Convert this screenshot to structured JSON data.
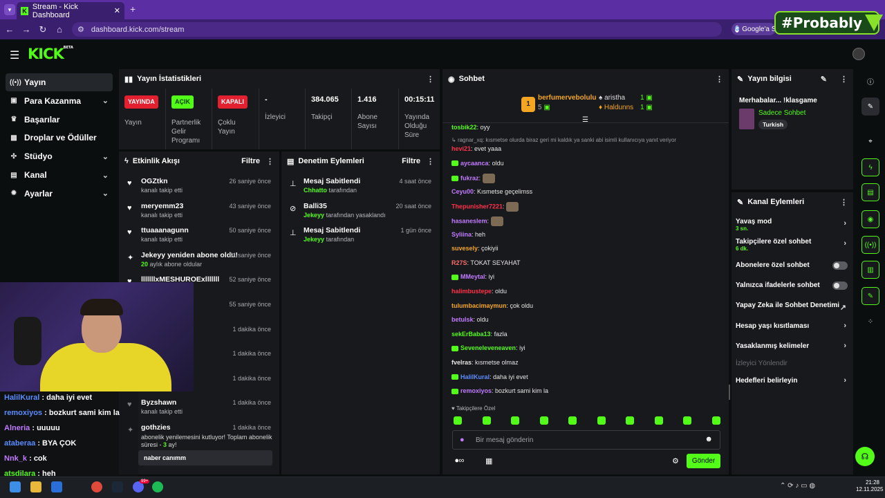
{
  "browser": {
    "tab_title": "Stream - Kick Dashboard",
    "url": "dashboard.kick.com/stream",
    "google_chip": "Google'a S",
    "watermark": "#Probably"
  },
  "header": {
    "logo": "KICK",
    "logo_sup": "BETA"
  },
  "sidebar": {
    "items": [
      {
        "label": "Yayın",
        "icon": "broadcast-icon",
        "active": true
      },
      {
        "label": "Para Kazanma",
        "icon": "money-icon",
        "chevron": true
      },
      {
        "label": "Başarılar",
        "icon": "trophy-icon"
      },
      {
        "label": "Droplar ve Ödüller",
        "icon": "gift-icon"
      },
      {
        "label": "Stüdyo",
        "icon": "studio-icon",
        "chevron": true
      },
      {
        "label": "Kanal",
        "icon": "channel-icon",
        "chevron": true
      },
      {
        "label": "Ayarlar",
        "icon": "gear-icon",
        "chevron": true
      }
    ]
  },
  "stats": {
    "title": "Yayın İstatistikleri",
    "cells": [
      {
        "badge": "YAYINDA",
        "label": "Yayın"
      },
      {
        "badge": "AÇIK",
        "label": "Partnerlik Gelir Programı"
      },
      {
        "badge": "KAPALI",
        "label": "Çoklu Yayın"
      },
      {
        "value": "-",
        "label": "İzleyici"
      },
      {
        "value": "384.065",
        "label": "Takipçi"
      },
      {
        "value": "1.416",
        "label": "Abone Sayısı"
      },
      {
        "value": "00:15:11",
        "label": "Yayında Olduğu Süre"
      }
    ]
  },
  "activity": {
    "title": "Etkinlik Akışı",
    "filter": "Filtre",
    "items": [
      {
        "name": "OGZtkn",
        "sub": "kanalı takip etti",
        "time": "26 saniye önce"
      },
      {
        "name": "meryemm23",
        "sub": "kanalı takip etti",
        "time": "43 saniye önce"
      },
      {
        "name": "ttuaaanagunn",
        "sub": "kanalı takip etti",
        "time": "50 saniye önce"
      },
      {
        "name": "Jekeyy yeniden abone oldu!",
        "sub_num": "20",
        "sub": "aylık abone oldular",
        "time": "51 saniye önce"
      },
      {
        "name": "lllllllxMESHUROExlllllll",
        "sub": "",
        "time": "52 saniye önce"
      },
      {
        "name": "",
        "sub": "",
        "time": "55 saniye önce"
      },
      {
        "name": "",
        "sub": "",
        "time": "1 dakika önce"
      },
      {
        "name": "",
        "sub": "",
        "time": "1 dakika önce"
      },
      {
        "name": "",
        "sub": "",
        "time": "1 dakika önce"
      },
      {
        "name": "Byzshawn",
        "sub": "kanalı takip etti",
        "time": "1 dakika önce"
      }
    ],
    "last": {
      "name": "gothzies",
      "time": "1 dakika önce",
      "line1": "abonelik yenilemesini kutluyor! Toplam abonelik",
      "line2a": "süresi - ",
      "line2num": "3",
      "line2b": " ay!",
      "quote": "naber canımm"
    }
  },
  "moderation": {
    "title": "Denetim Eylemleri",
    "filter": "Filtre",
    "items": [
      {
        "name": "Mesaj Sabitlendi",
        "user": "Chhatto",
        "by": "tarafından",
        "time": "4 saat önce"
      },
      {
        "name": "Balli35",
        "user": "Jekeyy",
        "by": "tarafından yasaklandı",
        "time": "20 saat önce"
      },
      {
        "name": "Mesaj Sabitlendi",
        "user": "Jekeyy",
        "by": "tarafından",
        "time": "1 gün önce"
      }
    ]
  },
  "chat": {
    "title": "Sohbet",
    "leaders": {
      "first": "berfumervebolulu",
      "first_count": "5",
      "second": "aristha",
      "second_count": "1",
      "third": "Haldunns",
      "third_count": "1",
      "rank": "1"
    },
    "reply_note": "ragnar_xq: kısmetse olurda biraz geri mi kaldık ya sanki abi isimli kullanıcıya yanıt veriyor",
    "messages": [
      {
        "user": "tosbik22",
        "color": "#53fc18",
        "text": "oyy"
      },
      {
        "user": "hevi21",
        "color": "#ff3048",
        "text": "evet yaaa"
      },
      {
        "user": "aycaanca",
        "color": "#c27bff",
        "text": "oldu",
        "badge": true
      },
      {
        "user": "fukraz",
        "color": "#c27bff",
        "text": "",
        "badge": true,
        "emote": true
      },
      {
        "user": "Ceyu00",
        "color": "#c27bff",
        "text": "Kısmetse geçelimss"
      },
      {
        "user": "Thepunisher7221",
        "color": "#ff3048",
        "text": "",
        "emote": true
      },
      {
        "user": "hasaneslem",
        "color": "#c27bff",
        "text": "",
        "emote": true
      },
      {
        "user": "Syliina",
        "color": "#c27bff",
        "text": "heh"
      },
      {
        "user": "suvesely",
        "color": "#f4a623",
        "text": "çokiyii"
      },
      {
        "user": "R27S",
        "color": "#ff6b6b",
        "text": "TOKAT SEYAHAT"
      },
      {
        "user": "MMeytal",
        "color": "#c27bff",
        "text": "iyi",
        "badge": true
      },
      {
        "user": "halimbustepe",
        "color": "#ff3048",
        "text": "oldu"
      },
      {
        "user": "tulumbacimaymun",
        "color": "#f4a623",
        "text": "çok oldu"
      },
      {
        "user": "betulsk",
        "color": "#c27bff",
        "text": "oldu"
      },
      {
        "user": "sekErBaba13",
        "color": "#53fc18",
        "text": "fazla"
      },
      {
        "user": "Seveneleveneaven",
        "color": "#53fc18",
        "text": "iyi",
        "badge": true
      },
      {
        "user": "fvelras",
        "color": "#e6e6e6",
        "text": "kısmetse olmaz"
      },
      {
        "user": "HalilKural",
        "color": "#5b8cff",
        "text": "daha iyi evet",
        "badge": true
      },
      {
        "user": "remoxiyos",
        "color": "#c27bff",
        "text": "bozkurt sami kim la",
        "badge": true
      }
    ],
    "followers_only": "Takipçilere Özel",
    "input_placeholder": "Bir mesaj gönderin",
    "send_label": "Gönder"
  },
  "stream_info": {
    "title": "Yayın bilgisi",
    "stream_title": "Merhabalar... !klasgame",
    "category": "Sadece Sohbet",
    "tag": "Turkish"
  },
  "channel_actions": {
    "title": "Kanal Eylemleri",
    "items": [
      {
        "label": "Yavaş mod",
        "sub": "3 sn.",
        "type": "chevron"
      },
      {
        "label": "Takipçilere özel sohbet",
        "sub": "6 dk.",
        "type": "chevron"
      },
      {
        "label": "Abonelere özel sohbet",
        "type": "toggle"
      },
      {
        "label": "Yalnızca ifadelerle sohbet",
        "type": "toggle"
      },
      {
        "label": "Yapay Zeka ile Sohbet Denetimi",
        "type": "external"
      },
      {
        "label": "Hesap yaşı kısıtlaması",
        "type": "chevron"
      },
      {
        "label": "Yasaklanmış kelimeler",
        "type": "chevron"
      },
      {
        "label": "İzleyici Yönlendir",
        "type": "disabled"
      },
      {
        "label": "Hedefleri belirleyin",
        "type": "chevron"
      }
    ]
  },
  "cam_chat": [
    {
      "user": "HalilKural",
      "color": "#5b8cff",
      "text": "daha iyi evet"
    },
    {
      "user": "remoxiyos",
      "color": "#5b8cff",
      "text": "bozkurt sami kim la"
    },
    {
      "user": "Alneria",
      "color": "#c27bff",
      "text": "uuuuu"
    },
    {
      "user": "ataberaa",
      "color": "#5b8cff",
      "text": "BYA ÇOK"
    },
    {
      "user": "Nnk_k",
      "color": "#c27bff",
      "text": "cok"
    },
    {
      "user": "atsdilara",
      "color": "#53fc18",
      "text": "heh"
    }
  ],
  "taskbar": {
    "time": "21:28",
    "date": "12.11.2025",
    "badge": "99+"
  },
  "colors": {
    "accent": "#53fc18",
    "live": "#e3202f",
    "panel": "#18191d",
    "bg": "#0b0e0f"
  }
}
